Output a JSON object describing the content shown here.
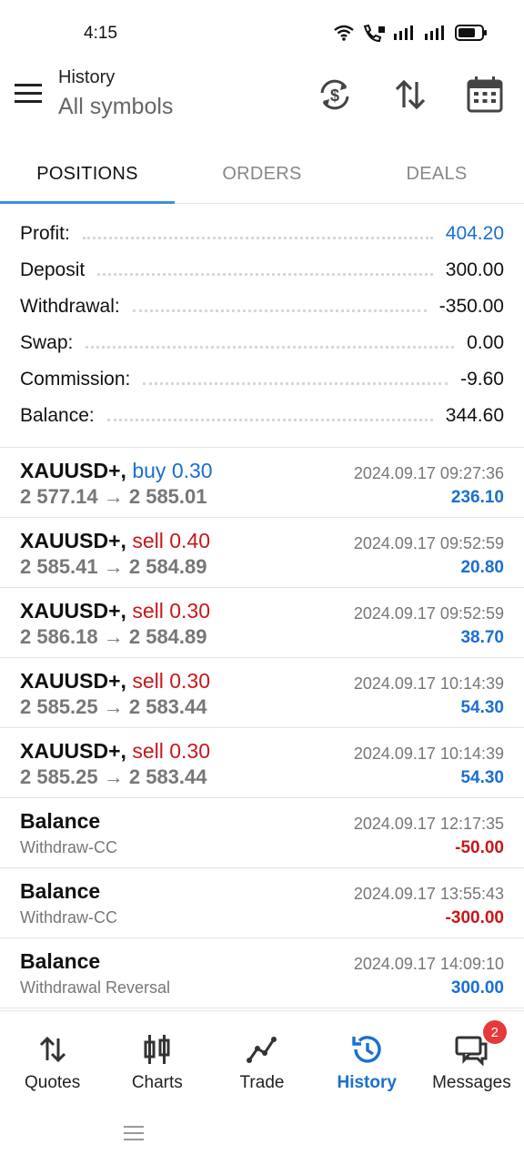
{
  "status_bar": {
    "time": "4:15"
  },
  "header": {
    "title": "History",
    "subtitle": "All symbols"
  },
  "tabs": [
    {
      "label": "POSITIONS",
      "active": true
    },
    {
      "label": "ORDERS",
      "active": false
    },
    {
      "label": "DEALS",
      "active": false
    }
  ],
  "summary": {
    "profit": {
      "label": "Profit:",
      "value": "404.20"
    },
    "deposit": {
      "label": "Deposit",
      "value": "300.00"
    },
    "withdrawal": {
      "label": "Withdrawal:",
      "value": "-350.00"
    },
    "swap": {
      "label": "Swap:",
      "value": "0.00"
    },
    "commission": {
      "label": "Commission:",
      "value": "-9.60"
    },
    "balance": {
      "label": "Balance:",
      "value": "344.60"
    }
  },
  "history": [
    {
      "symbol": "XAUUSD+,",
      "side": "buy 0.30",
      "prices": "2 577.14 → 2 585.01",
      "time": "2024.09.17 09:27:36",
      "profit": "236.10"
    },
    {
      "symbol": "XAUUSD+,",
      "side": "sell 0.40",
      "prices": "2 585.41 → 2 584.89",
      "time": "2024.09.17 09:52:59",
      "profit": "20.80"
    },
    {
      "symbol": "XAUUSD+,",
      "side": "sell 0.30",
      "prices": "2 586.18 → 2 584.89",
      "time": "2024.09.17 09:52:59",
      "profit": "38.70"
    },
    {
      "symbol": "XAUUSD+,",
      "side": "sell 0.30",
      "prices": "2 585.25 → 2 583.44",
      "time": "2024.09.17 10:14:39",
      "profit": "54.30"
    },
    {
      "symbol": "XAUUSD+,",
      "side": "sell 0.30",
      "prices": "2 585.25 → 2 583.44",
      "time": "2024.09.17 10:14:39",
      "profit": "54.30"
    },
    {
      "symbol": "Balance",
      "comment": "Withdraw-CC",
      "time": "2024.09.17 12:17:35",
      "profit": "-50.00"
    },
    {
      "symbol": "Balance",
      "comment": "Withdraw-CC",
      "time": "2024.09.17 13:55:43",
      "profit": "-300.00"
    },
    {
      "symbol": "Balance",
      "comment": "Withdrawal Reversal",
      "time": "2024.09.17 14:09:10",
      "profit": "300.00"
    }
  ],
  "bottom_nav": {
    "quotes": "Quotes",
    "charts": "Charts",
    "trade": "Trade",
    "history": "History",
    "messages": "Messages",
    "messages_badge": "2"
  },
  "colors": {
    "accent": "#1a6fd1",
    "negative": "#c8171b",
    "badge": "#e5393a"
  }
}
